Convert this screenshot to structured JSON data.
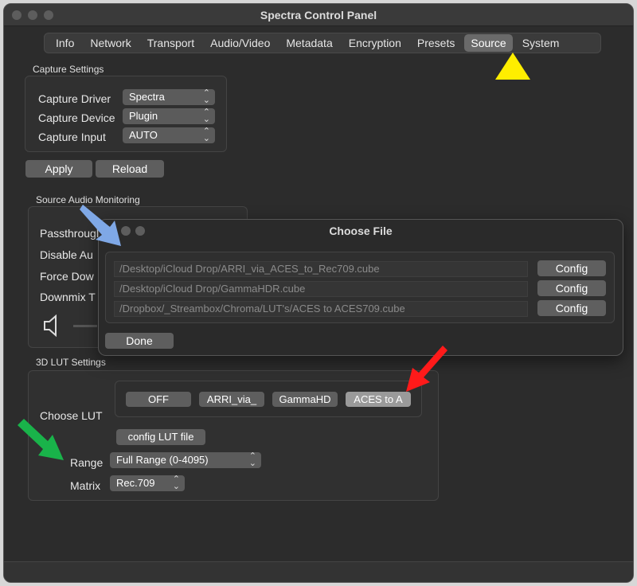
{
  "window": {
    "title": "Spectra Control Panel"
  },
  "tabs": [
    "Info",
    "Network",
    "Transport",
    "Audio/Video",
    "Metadata",
    "Encryption",
    "Presets",
    "Source",
    "System"
  ],
  "active_tab": "Source",
  "capture": {
    "section_title": "Capture Settings",
    "driver_label": "Capture Driver",
    "driver_value": "Spectra",
    "device_label": "Capture Device",
    "device_value": "Plugin",
    "input_label": "Capture Input",
    "input_value": "AUTO",
    "apply_label": "Apply",
    "reload_label": "Reload"
  },
  "audio": {
    "section_title": "Source Audio Monitoring",
    "rows": [
      "Passthrough",
      "Disable Au",
      "Force Dow",
      "Downmix T"
    ]
  },
  "dialog": {
    "title": "Choose File",
    "files": [
      "/Desktop/iCloud Drop/ARRI_via_ACES_to_Rec709.cube",
      "/Desktop/iCloud Drop/GammaHDR.cube",
      "/Dropbox/_Streambox/Chroma/LUT's/ACES to ACES709.cube"
    ],
    "config_label": "Config",
    "done_label": "Done"
  },
  "lut": {
    "section_title": "3D LUT Settings",
    "choose_label": "Choose LUT",
    "buttons": [
      "OFF",
      "ARRI_via_",
      "GammaHD",
      "ACES to A"
    ],
    "config_button": "config LUT file",
    "range_label": "Range",
    "range_value": "Full Range (0-4095)",
    "matrix_label": "Matrix",
    "matrix_value": "Rec.709"
  },
  "colors": {
    "yellow_arrow": "#ffee00",
    "blue_arrow": "#7fa8e6",
    "red_arrow": "#ff1a1a",
    "green_arrow": "#19b34a"
  },
  "icons": {
    "speaker": "speaker-icon",
    "chevron": "chevron-updown-icon"
  }
}
